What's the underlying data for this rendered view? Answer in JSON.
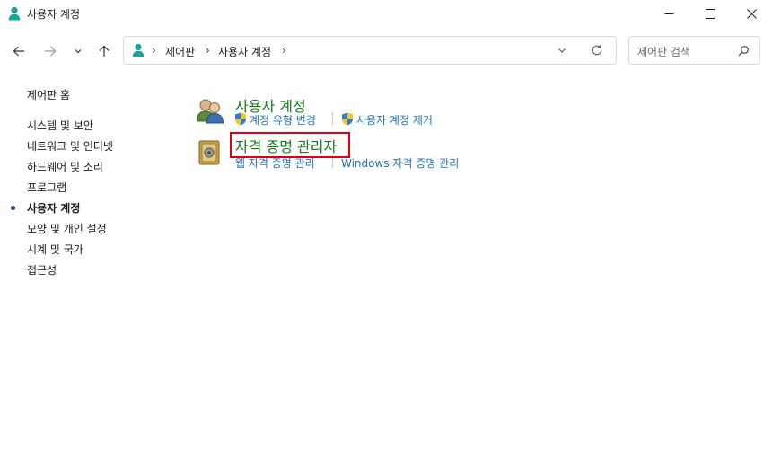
{
  "window": {
    "title": "사용자 계정"
  },
  "address": {
    "crumbs": [
      "제어판",
      "사용자 계정"
    ],
    "separator": "›"
  },
  "search": {
    "placeholder": "제어판 검색"
  },
  "sidebar": {
    "home": "제어판 홈",
    "items": [
      {
        "label": "시스템 및 보안"
      },
      {
        "label": "네트워크 및 인터넷"
      },
      {
        "label": "하드웨어 및 소리"
      },
      {
        "label": "프로그램"
      },
      {
        "label": "사용자 계정",
        "active": true
      },
      {
        "label": "모양 및 개인 설정"
      },
      {
        "label": "시계 및 국가"
      },
      {
        "label": "접근성"
      }
    ]
  },
  "categories": [
    {
      "title": "사용자 계정",
      "links": [
        {
          "label": "계정 유형 변경",
          "icon": "uac-shield-icon"
        },
        {
          "label": "사용자 계정 제거",
          "icon": "uac-shield-icon"
        }
      ]
    },
    {
      "title": "자격 증명 관리자",
      "highlighted": true,
      "links": [
        {
          "label": "웹 자격 증명 관리"
        },
        {
          "label": "Windows 자격 증명 관리"
        }
      ]
    }
  ],
  "colors": {
    "category_title": "#1a7a1a",
    "link": "#1f6fb8",
    "highlight": "#e0000f"
  }
}
